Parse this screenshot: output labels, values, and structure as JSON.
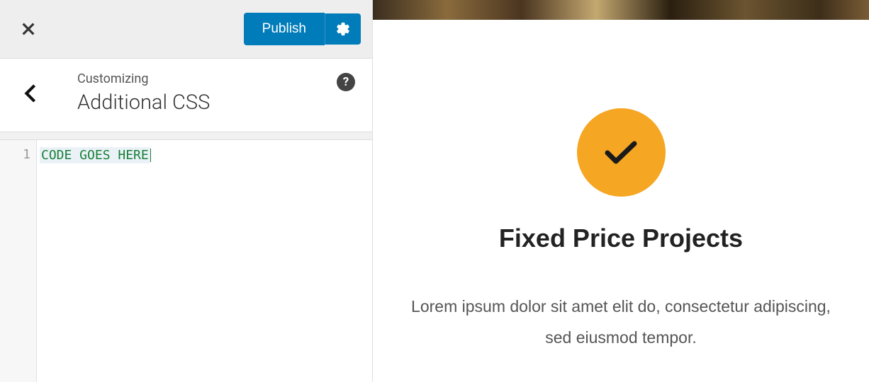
{
  "topbar": {
    "publish_label": "Publish"
  },
  "section": {
    "breadcrumb": "Customizing",
    "title": "Additional CSS",
    "help_glyph": "?"
  },
  "editor": {
    "line_number": "1",
    "code": "CODE GOES HERE"
  },
  "preview": {
    "title": "Fixed Price Projects",
    "body": "Lorem ipsum dolor sit amet elit do, consectetur adipiscing, sed eiusmod tempor."
  }
}
